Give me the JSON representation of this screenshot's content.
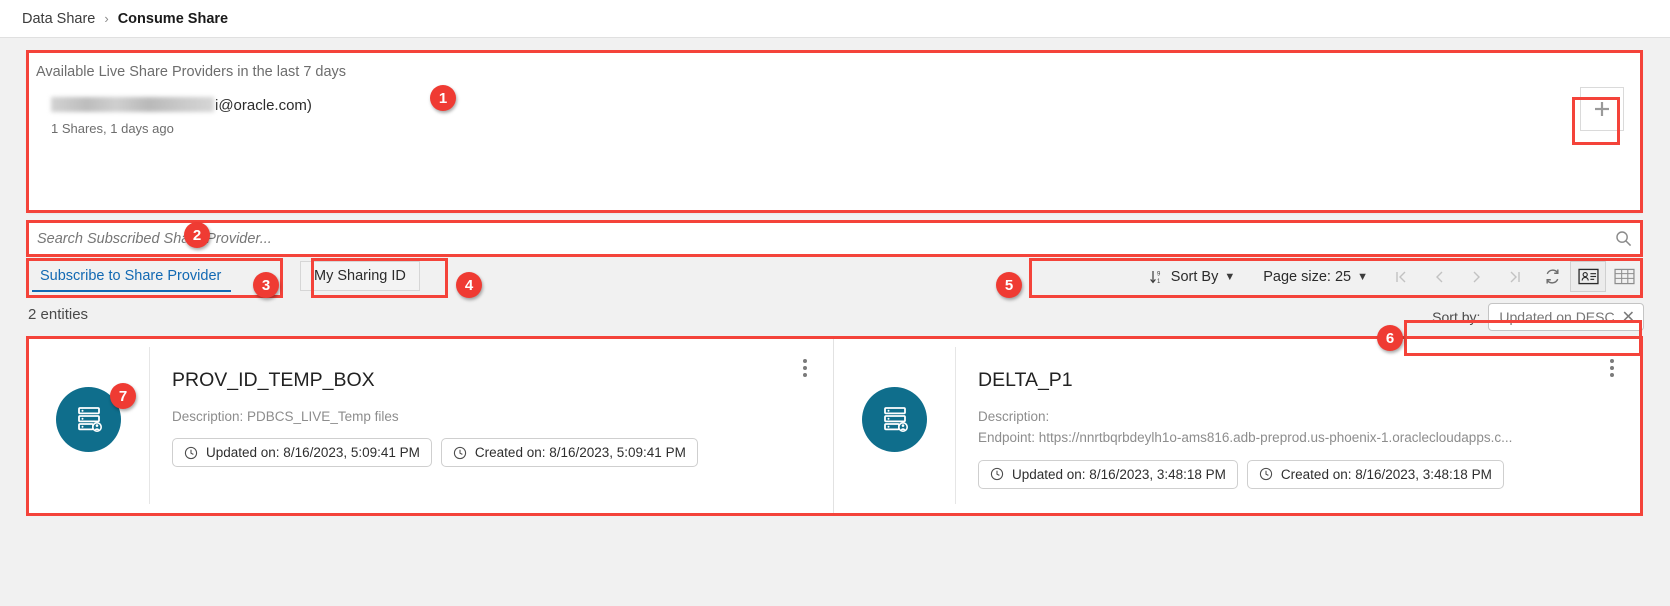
{
  "breadcrumb": {
    "parent": "Data Share",
    "separator": "›",
    "current": "Consume Share"
  },
  "providers_panel": {
    "title": "Available Live Share Providers in the last 7 days",
    "provider_email_visible": "i@oracle.com)",
    "provider_meta": "1 Shares, 1 days ago",
    "add_button_label": "+"
  },
  "search": {
    "placeholder": "Search Subscribed Share Provider...",
    "value": "",
    "icon": "search-icon"
  },
  "actions": {
    "subscribe_tab": "Subscribe to Share Provider",
    "my_sharing_id": "My Sharing ID"
  },
  "toolbar": {
    "sort_by_label": "Sort By",
    "sort_icon": "sort-descending-icon",
    "page_size_label": "Page size: 25",
    "caret": "▼",
    "pagination": {
      "first": "|‹",
      "prev": "‹",
      "next": "›",
      "last": "›|"
    },
    "refresh_icon": "refresh-icon",
    "card_view_icon": "card-view-icon",
    "table_view_icon": "table-view-icon"
  },
  "list_header": {
    "entities_count": "2 entities",
    "sort_by_prefix": "Sort by:",
    "sort_chip_value": "Updated on DESC",
    "sort_chip_close": "✕"
  },
  "cards": [
    {
      "icon": "share-provider-icon",
      "title": "PROV_ID_TEMP_BOX",
      "description": "Description: PDBCS_LIVE_Temp files",
      "description_line2": "",
      "updated_on": "Updated on: 8/16/2023, 5:09:41 PM",
      "created_on": "Created on: 8/16/2023, 5:09:41 PM",
      "menu_icon": "kebab-menu-icon"
    },
    {
      "icon": "share-provider-icon",
      "title": "DELTA_P1",
      "description": "Description:",
      "description_line2": "Endpoint: https://nnrtbqrbdeylh1o-ams816.adb-preprod.us-phoenix-1.oraclecloudapps.c...",
      "updated_on": "Updated on: 8/16/2023, 3:48:18 PM",
      "created_on": "Created on: 8/16/2023, 3:48:18 PM",
      "menu_icon": "kebab-menu-icon"
    }
  ],
  "annotations": [
    {
      "number": "1"
    },
    {
      "number": "2"
    },
    {
      "number": "3"
    },
    {
      "number": "4"
    },
    {
      "number": "5"
    },
    {
      "number": "6"
    },
    {
      "number": "7"
    }
  ],
  "colors": {
    "annotation_red": "#f4433a",
    "accent_blue": "#1269b3",
    "icon_teal": "#0f6e8c"
  }
}
